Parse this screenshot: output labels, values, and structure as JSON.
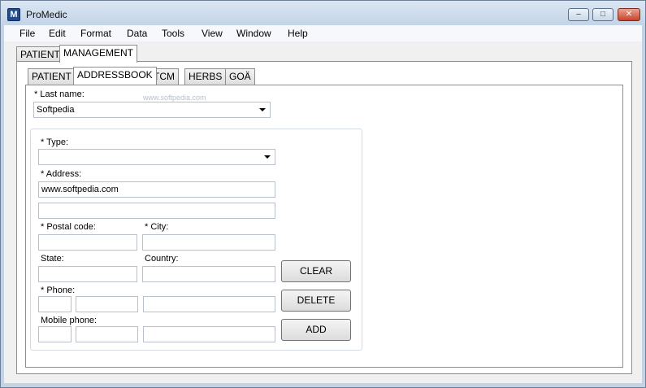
{
  "window": {
    "title": "ProMedic",
    "icon": "app-logo-icon"
  },
  "menu": [
    "File",
    "Edit",
    "Format",
    "Data",
    "Tools",
    "View",
    "Window",
    "Help"
  ],
  "outer_tabs": [
    "PATIENT",
    "MANAGEMENT"
  ],
  "inner_tabs": [
    "PATIENT",
    "ADDRESSBOOK",
    "TCM",
    "HERBS",
    "GOÄ"
  ],
  "form": {
    "last_name_label": "* Last name:",
    "last_name_value": "Softpedia",
    "type_label": "* Type:",
    "type_value": "",
    "address_label": "* Address:",
    "address_line1": "www.softpedia.com",
    "address_line2": "",
    "postal_label": "* Postal code:",
    "postal_value": "",
    "city_label": "* City:",
    "city_value": "",
    "state_label": "State:",
    "state_value": "",
    "country_label": "Country:",
    "country_value": "",
    "phone_label": "* Phone:",
    "mobile_label": "Mobile phone:"
  },
  "buttons": {
    "clear": "CLEAR",
    "delete": "DELETE",
    "add": "ADD"
  },
  "watermark": "www.softpedia.com"
}
